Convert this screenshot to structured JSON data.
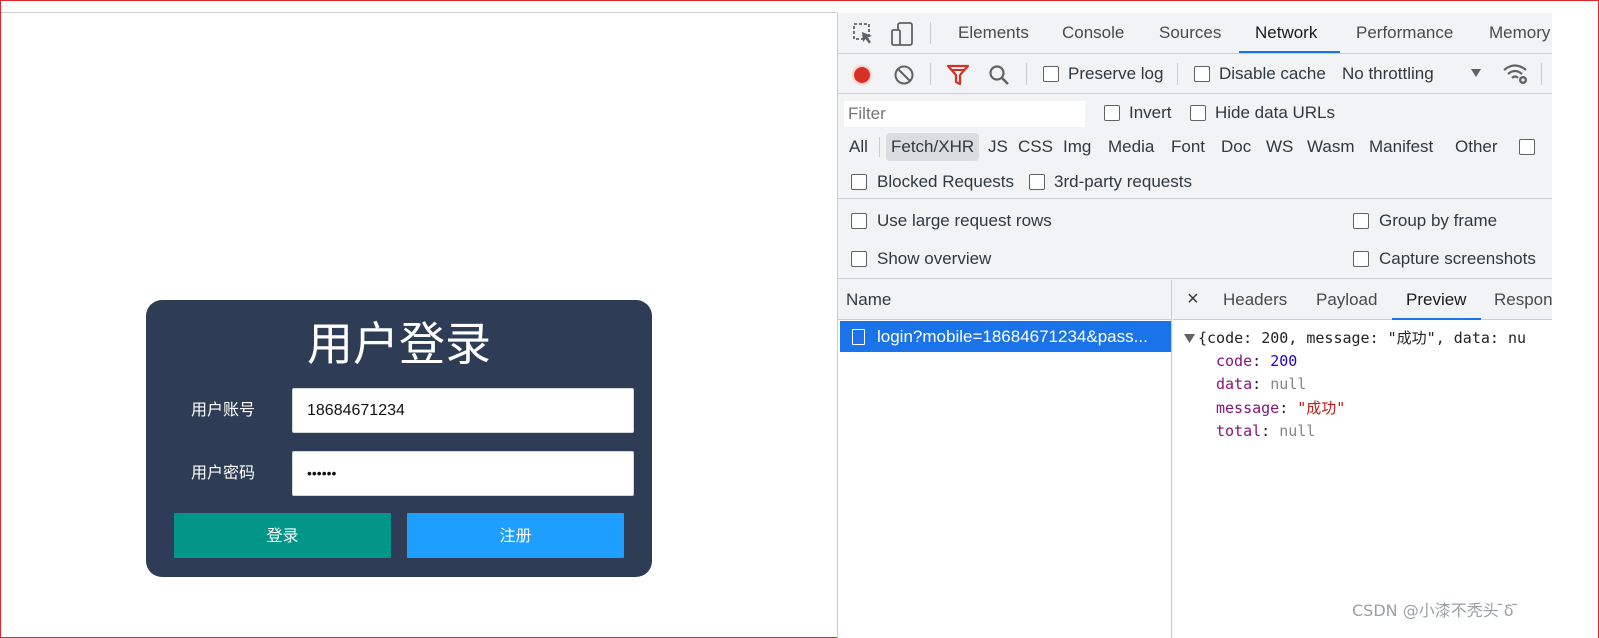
{
  "login_card": {
    "title": "用户登录",
    "account_label": "用户账号",
    "account_value": "18684671234",
    "password_label": "用户密码",
    "password_value": "••••••",
    "login_button": "登录",
    "register_button": "注册"
  },
  "devtools": {
    "tabs": [
      "Elements",
      "Console",
      "Sources",
      "Network",
      "Performance",
      "Memory"
    ],
    "active_tab": "Network",
    "toolbar": {
      "preserve_log": "Preserve log",
      "disable_cache": "Disable cache",
      "throttling": "No throttling"
    },
    "filter": {
      "placeholder": "Filter",
      "invert": "Invert",
      "hide_data_urls": "Hide data URLs"
    },
    "types": [
      "All",
      "Fetch/XHR",
      "JS",
      "CSS",
      "Img",
      "Media",
      "Font",
      "Doc",
      "WS",
      "Wasm",
      "Manifest",
      "Other"
    ],
    "active_type": "Fetch/XHR",
    "blocked_requests": "Blocked Requests",
    "third_party": "3rd-party requests",
    "settings": {
      "large_rows": "Use large request rows",
      "group_by_frame": "Group by frame",
      "show_overview": "Show overview",
      "capture_screenshots": "Capture screenshots"
    },
    "list": {
      "header": "Name",
      "items": [
        "login?mobile=18684671234&pass..."
      ]
    },
    "detail": {
      "close": "×",
      "tabs": [
        "Headers",
        "Payload",
        "Preview",
        "Respon"
      ],
      "active_tab": "Preview",
      "preview": {
        "summary": "{code: 200, message: \"成功\", data: nu",
        "fields": [
          {
            "key": "code",
            "value": "200",
            "kind": "number"
          },
          {
            "key": "data",
            "value": "null",
            "kind": "null"
          },
          {
            "key": "message",
            "value": "\"成功\"",
            "kind": "string"
          },
          {
            "key": "total",
            "value": "null",
            "kind": "null"
          }
        ]
      }
    }
  },
  "watermark": "CSDN @小漆不秃头 ̄δ ̄",
  "colors": {
    "card_bg": "#2e3d55",
    "login_button": "#009688",
    "register_button": "#1e9fff",
    "selected_row": "#1a73e8",
    "record_red": "#d93025"
  }
}
